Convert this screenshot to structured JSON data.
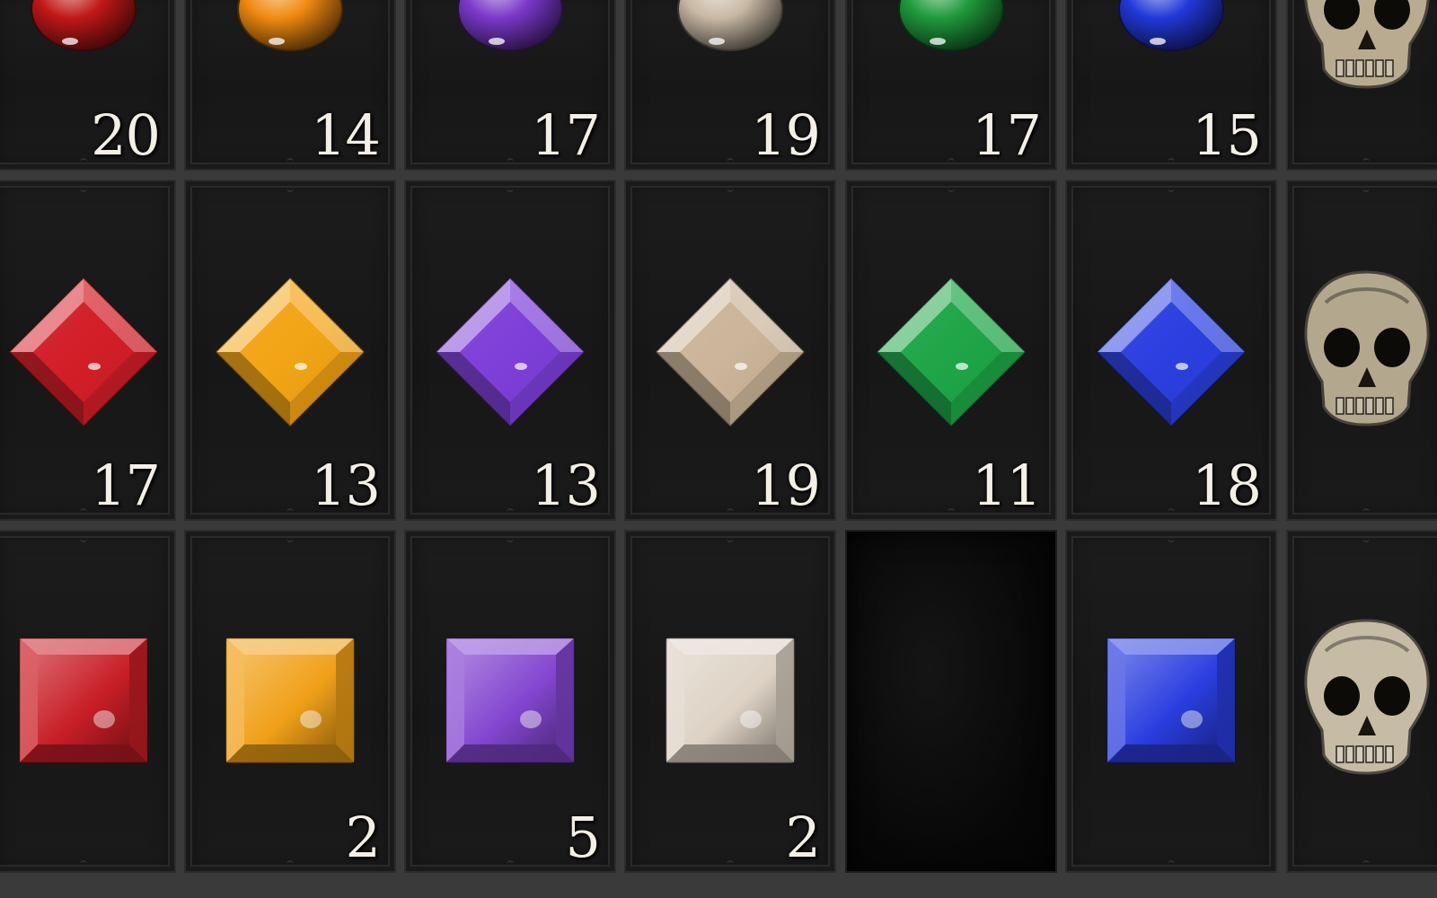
{
  "stash": {
    "rows": [
      {
        "cells": [
          {
            "item": "chipped-ruby",
            "icon": "ruby-round-icon",
            "color": "#c01818",
            "quantity": "20"
          },
          {
            "item": "chipped-topaz",
            "icon": "topaz-round-icon",
            "color": "#f08a10",
            "quantity": "14"
          },
          {
            "item": "chipped-amethyst",
            "icon": "amethyst-round-icon",
            "color": "#7a38c8",
            "quantity": "17"
          },
          {
            "item": "chipped-diamond",
            "icon": "diamond-round-icon",
            "color": "#c8b8a4",
            "quantity": "19"
          },
          {
            "item": "chipped-emerald",
            "icon": "emerald-round-icon",
            "color": "#1f9a3c",
            "quantity": "17"
          },
          {
            "item": "chipped-sapphire",
            "icon": "sapphire-round-icon",
            "color": "#2238d8",
            "quantity": "15"
          },
          {
            "item": "chipped-skull",
            "icon": "skull-icon",
            "color": "#b8ab90",
            "quantity": ""
          }
        ]
      },
      {
        "cells": [
          {
            "item": "flawed-ruby",
            "icon": "ruby-diamond-icon",
            "color": "#d21f28",
            "quantity": "17"
          },
          {
            "item": "flawed-topaz",
            "icon": "topaz-diamond-icon",
            "color": "#f2a416",
            "quantity": "13"
          },
          {
            "item": "flawed-amethyst",
            "icon": "amethyst-diamond-icon",
            "color": "#7e40d8",
            "quantity": "13"
          },
          {
            "item": "flawed-diamond",
            "icon": "diamond-diamond-icon",
            "color": "#cbb59a",
            "quantity": "19"
          },
          {
            "item": "flawed-emerald",
            "icon": "emerald-diamond-icon",
            "color": "#1fa648",
            "quantity": "11"
          },
          {
            "item": "flawed-sapphire",
            "icon": "sapphire-diamond-icon",
            "color": "#2c40e0",
            "quantity": "18"
          },
          {
            "item": "flawed-skull",
            "icon": "skull-icon",
            "color": "#b3a78e",
            "quantity": ""
          }
        ]
      },
      {
        "cells": [
          {
            "item": "standard-ruby",
            "icon": "ruby-square-icon",
            "color": "#c81e26",
            "quantity": ""
          },
          {
            "item": "standard-topaz",
            "icon": "topaz-square-icon",
            "color": "#f0a018",
            "quantity": "2"
          },
          {
            "item": "standard-amethyst",
            "icon": "amethyst-square-icon",
            "color": "#8446d0",
            "quantity": "5"
          },
          {
            "item": "standard-diamond",
            "icon": "diamond-square-icon",
            "color": "#ddd2c4",
            "quantity": "2"
          },
          {
            "item": "empty-slot",
            "icon": "",
            "color": "",
            "quantity": ""
          },
          {
            "item": "standard-sapphire",
            "icon": "sapphire-square-icon",
            "color": "#2a3ee0",
            "quantity": ""
          },
          {
            "item": "standard-skull",
            "icon": "skull-icon",
            "color": "#c6bca6",
            "quantity": ""
          }
        ]
      }
    ]
  }
}
